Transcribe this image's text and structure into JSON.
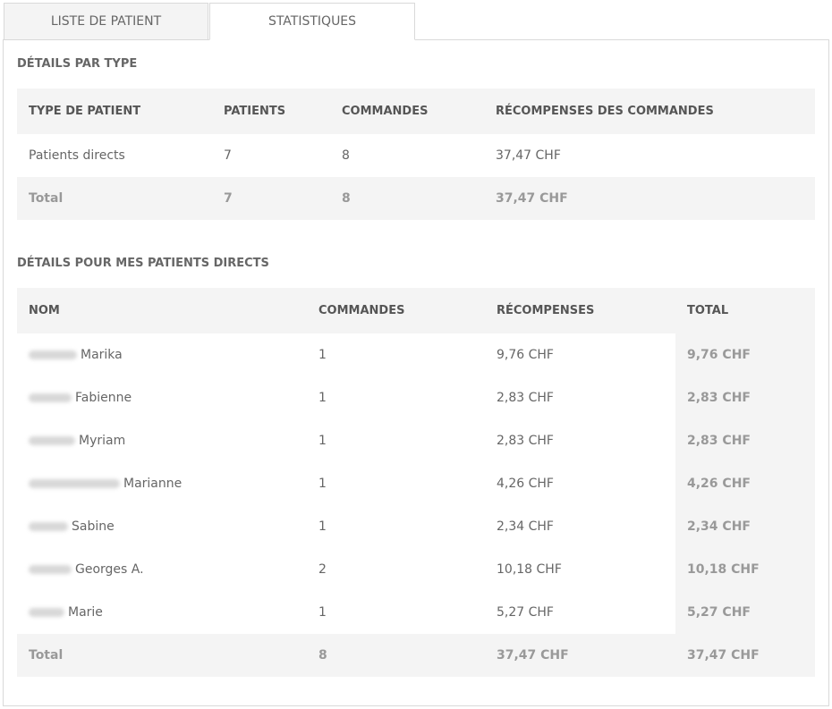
{
  "tabs": [
    {
      "label": "LISTE DE PATIENT",
      "active": false
    },
    {
      "label": "STATISTIQUES",
      "active": true
    }
  ],
  "type_section": {
    "title": "DÉTAILS PAR TYPE",
    "headers": [
      "TYPE DE PATIENT",
      "PATIENTS",
      "COMMANDES",
      "RÉCOMPENSES DES COMMANDES"
    ],
    "rows": [
      [
        "Patients directs",
        "7",
        "8",
        "37,47 CHF"
      ]
    ],
    "total": [
      "Total",
      "7",
      "8",
      "37,47 CHF"
    ]
  },
  "direct_section": {
    "title": "DÉTAILS POUR MES PATIENTS DIRECTS",
    "headers": [
      "NOM",
      "COMMANDES",
      "RÉCOMPENSES",
      "TOTAL"
    ],
    "rows": [
      {
        "name": "Marika",
        "commandes": "1",
        "recompenses": "9,76 CHF",
        "total": "9,76 CHF"
      },
      {
        "name": "Fabienne",
        "commandes": "1",
        "recompenses": "2,83 CHF",
        "total": "2,83 CHF"
      },
      {
        "name": "Myriam",
        "commandes": "1",
        "recompenses": "2,83 CHF",
        "total": "2,83 CHF"
      },
      {
        "name": "Marianne",
        "commandes": "1",
        "recompenses": "4,26 CHF",
        "total": "4,26 CHF"
      },
      {
        "name": "Sabine",
        "commandes": "1",
        "recompenses": "2,34 CHF",
        "total": "2,34 CHF"
      },
      {
        "name": "Georges A.",
        "commandes": "2",
        "recompenses": "10,18 CHF",
        "total": "10,18 CHF"
      },
      {
        "name": "Marie",
        "commandes": "1",
        "recompenses": "5,27 CHF",
        "total": "5,27 CHF"
      }
    ],
    "total": {
      "label": "Total",
      "commandes": "8",
      "recompenses": "37,47 CHF",
      "total": "37,47 CHF"
    }
  },
  "colors": {
    "header_bg": "#f4f4f4",
    "border": "#d9d9d9",
    "text": "#666666",
    "total_text": "#999999"
  }
}
